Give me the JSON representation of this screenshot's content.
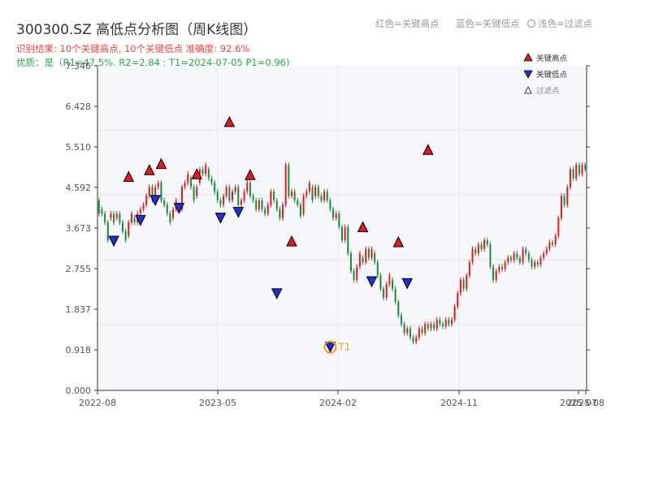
{
  "header": {
    "title": "300300.SZ 高低点分析图（周K线图）",
    "stats": "识别结果: 10个关键高点, 10个关键低点   准确度: 92.6%",
    "quality": "优质：是（R1=47.5%, R2=2.84 ; T1=2024-07-05 P1=0.96)",
    "legend_top": [
      "红色=关键高点",
      "蓝色=关键低点",
      "浅色=过滤点"
    ]
  },
  "colors": {
    "up": "#e3191c",
    "down": "#1a8a3a",
    "high": "#e3191c",
    "low": "#1f2fd6",
    "t1": "#f29b1f",
    "bg": "#f5f7fa"
  },
  "chart_data": {
    "type": "candlestick",
    "legend": [
      "关键高点",
      "关键低点",
      "过滤点"
    ],
    "ylim": [
      0,
      7.346
    ],
    "y_ticks": [
      "0.000",
      "0.918",
      "1.837",
      "2.755",
      "3.673",
      "4.592",
      "5.510",
      "6.428",
      "7.346"
    ],
    "x_ticks": [
      "2022-08",
      "2023-05",
      "2024-02",
      "2024-11",
      "2025-07",
      "2025-08"
    ],
    "candles": [
      [
        4.3,
        4.0
      ],
      [
        4.1,
        4.0
      ],
      [
        4.0,
        3.8
      ],
      [
        3.8,
        3.4
      ],
      [
        3.9,
        4.0
      ],
      [
        4.0,
        3.8
      ],
      [
        3.9,
        4.0
      ],
      [
        4.0,
        3.8
      ],
      [
        3.8,
        3.6
      ],
      [
        3.6,
        3.4
      ],
      [
        3.5,
        3.8
      ],
      [
        3.8,
        4.0
      ],
      [
        3.9,
        3.8
      ],
      [
        3.8,
        4.0
      ],
      [
        4.0,
        4.1
      ],
      [
        4.1,
        4.2
      ],
      [
        4.2,
        4.4
      ],
      [
        4.4,
        4.6
      ],
      [
        4.6,
        4.3
      ],
      [
        4.3,
        4.6
      ],
      [
        4.6,
        4.7
      ],
      [
        4.7,
        4.3
      ],
      [
        4.3,
        4.2
      ],
      [
        4.2,
        4.0
      ],
      [
        4.0,
        3.8
      ],
      [
        3.9,
        4.1
      ],
      [
        4.1,
        4.3
      ],
      [
        4.2,
        4.1
      ],
      [
        4.1,
        4.6
      ],
      [
        4.6,
        4.7
      ],
      [
        4.7,
        4.9
      ],
      [
        4.8,
        4.6
      ],
      [
        4.6,
        4.3
      ],
      [
        4.4,
        4.6
      ],
      [
        4.7,
        5.0
      ],
      [
        5.0,
        4.9
      ],
      [
        4.9,
        5.1
      ],
      [
        5.0,
        4.8
      ],
      [
        4.8,
        4.7
      ],
      [
        4.7,
        4.5
      ],
      [
        4.5,
        4.3
      ],
      [
        4.3,
        4.2
      ],
      [
        4.2,
        4.4
      ],
      [
        4.4,
        4.6
      ],
      [
        4.6,
        4.3
      ],
      [
        4.3,
        4.5
      ],
      [
        4.5,
        4.6
      ],
      [
        4.6,
        4.2
      ],
      [
        4.2,
        4.3
      ],
      [
        4.3,
        4.5
      ],
      [
        4.5,
        4.7
      ],
      [
        4.7,
        4.4
      ],
      [
        4.4,
        4.3
      ],
      [
        4.3,
        4.1
      ],
      [
        4.1,
        4.3
      ],
      [
        4.3,
        4.1
      ],
      [
        4.1,
        4.0
      ],
      [
        4.0,
        4.2
      ],
      [
        4.2,
        4.5
      ],
      [
        4.5,
        4.3
      ],
      [
        4.3,
        4.1
      ],
      [
        4.1,
        3.9
      ],
      [
        3.9,
        4.2
      ],
      [
        4.2,
        5.1
      ],
      [
        5.1,
        4.4
      ],
      [
        4.4,
        4.5
      ],
      [
        4.5,
        4.3
      ],
      [
        4.3,
        4.2
      ],
      [
        4.2,
        3.95
      ],
      [
        4.0,
        4.4
      ],
      [
        4.4,
        4.5
      ],
      [
        4.5,
        4.7
      ],
      [
        4.6,
        4.3
      ],
      [
        4.4,
        4.6
      ],
      [
        4.6,
        4.4
      ],
      [
        4.4,
        4.3
      ],
      [
        4.3,
        4.5
      ],
      [
        4.5,
        4.3
      ],
      [
        4.3,
        4.1
      ],
      [
        4.1,
        3.9
      ],
      [
        3.9,
        4.0
      ],
      [
        4.0,
        3.7
      ],
      [
        3.7,
        3.4
      ],
      [
        3.4,
        3.7
      ],
      [
        3.7,
        3.1
      ],
      [
        3.1,
        2.7
      ],
      [
        2.7,
        2.5
      ],
      [
        2.5,
        2.8
      ],
      [
        2.8,
        3.1
      ],
      [
        3.0,
        2.9
      ],
      [
        2.9,
        3.2
      ],
      [
        3.2,
        3.0
      ],
      [
        3.0,
        3.2
      ],
      [
        3.1,
        2.9
      ],
      [
        2.9,
        2.6
      ],
      [
        2.6,
        2.3
      ],
      [
        2.3,
        2.1
      ],
      [
        2.1,
        2.4
      ],
      [
        2.4,
        2.6
      ],
      [
        2.5,
        2.3
      ],
      [
        2.3,
        2.0
      ],
      [
        2.0,
        1.7
      ],
      [
        1.7,
        1.5
      ],
      [
        1.5,
        1.3
      ],
      [
        1.3,
        1.4
      ],
      [
        1.4,
        1.2
      ],
      [
        1.2,
        1.1
      ],
      [
        1.1,
        1.2
      ],
      [
        1.2,
        1.4
      ],
      [
        1.4,
        1.3
      ],
      [
        1.3,
        1.5
      ],
      [
        1.5,
        1.4
      ],
      [
        1.4,
        1.5
      ],
      [
        1.5,
        1.4
      ],
      [
        1.4,
        1.6
      ],
      [
        1.6,
        1.5
      ],
      [
        1.5,
        1.45
      ],
      [
        1.45,
        1.6
      ],
      [
        1.6,
        1.5
      ],
      [
        1.5,
        1.6
      ],
      [
        1.6,
        1.9
      ],
      [
        1.9,
        2.2
      ],
      [
        2.2,
        2.5
      ],
      [
        2.5,
        2.3
      ],
      [
        2.3,
        2.6
      ],
      [
        2.6,
        2.9
      ],
      [
        2.9,
        3.2
      ],
      [
        3.2,
        3.1
      ],
      [
        3.1,
        3.3
      ],
      [
        3.3,
        3.2
      ],
      [
        3.2,
        3.4
      ],
      [
        3.4,
        3.3
      ],
      [
        3.3,
        2.8
      ],
      [
        2.8,
        2.5
      ],
      [
        2.5,
        2.7
      ],
      [
        2.7,
        2.8
      ],
      [
        2.8,
        2.75
      ],
      [
        2.75,
        2.9
      ],
      [
        2.9,
        3.0
      ],
      [
        3.0,
        2.95
      ],
      [
        2.95,
        3.1
      ],
      [
        3.1,
        3.0
      ],
      [
        3.0,
        2.9
      ],
      [
        2.9,
        3.2
      ],
      [
        3.2,
        3.1
      ],
      [
        3.1,
        2.95
      ],
      [
        2.95,
        2.8
      ],
      [
        2.8,
        2.9
      ],
      [
        2.9,
        2.85
      ],
      [
        2.85,
        3.0
      ],
      [
        3.0,
        3.1
      ],
      [
        3.1,
        3.2
      ],
      [
        3.2,
        3.35
      ],
      [
        3.35,
        3.3
      ],
      [
        3.3,
        3.5
      ],
      [
        3.5,
        3.9
      ],
      [
        3.9,
        4.4
      ],
      [
        4.4,
        4.2
      ],
      [
        4.2,
        4.6
      ],
      [
        4.6,
        5.0
      ],
      [
        5.0,
        4.8
      ],
      [
        4.8,
        5.1
      ],
      [
        5.1,
        4.9
      ],
      [
        4.9,
        5.1
      ],
      [
        5.1,
        5.0
      ]
    ],
    "key_highs": [
      {
        "index": 10,
        "value": 4.84
      },
      {
        "index": 17,
        "value": 4.99
      },
      {
        "index": 21,
        "value": 5.13
      },
      {
        "index": 33,
        "value": 4.9
      },
      {
        "index": 44,
        "value": 6.08
      },
      {
        "index": 51,
        "value": 4.88
      },
      {
        "index": 65,
        "value": 3.38
      },
      {
        "index": 89,
        "value": 3.7
      },
      {
        "index": 101,
        "value": 3.36
      },
      {
        "index": 111,
        "value": 5.45
      }
    ],
    "key_lows": [
      {
        "index": 5,
        "value": 3.38
      },
      {
        "index": 14,
        "value": 3.85
      },
      {
        "index": 19,
        "value": 4.3
      },
      {
        "index": 27,
        "value": 4.12
      },
      {
        "index": 41,
        "value": 3.9
      },
      {
        "index": 47,
        "value": 4.03
      },
      {
        "index": 60,
        "value": 2.19
      },
      {
        "index": 78,
        "value": 0.98
      },
      {
        "index": 92,
        "value": 2.46
      },
      {
        "index": 104,
        "value": 2.42
      }
    ],
    "annotation": {
      "label": "T1",
      "index": 78,
      "value": 0.98
    }
  }
}
